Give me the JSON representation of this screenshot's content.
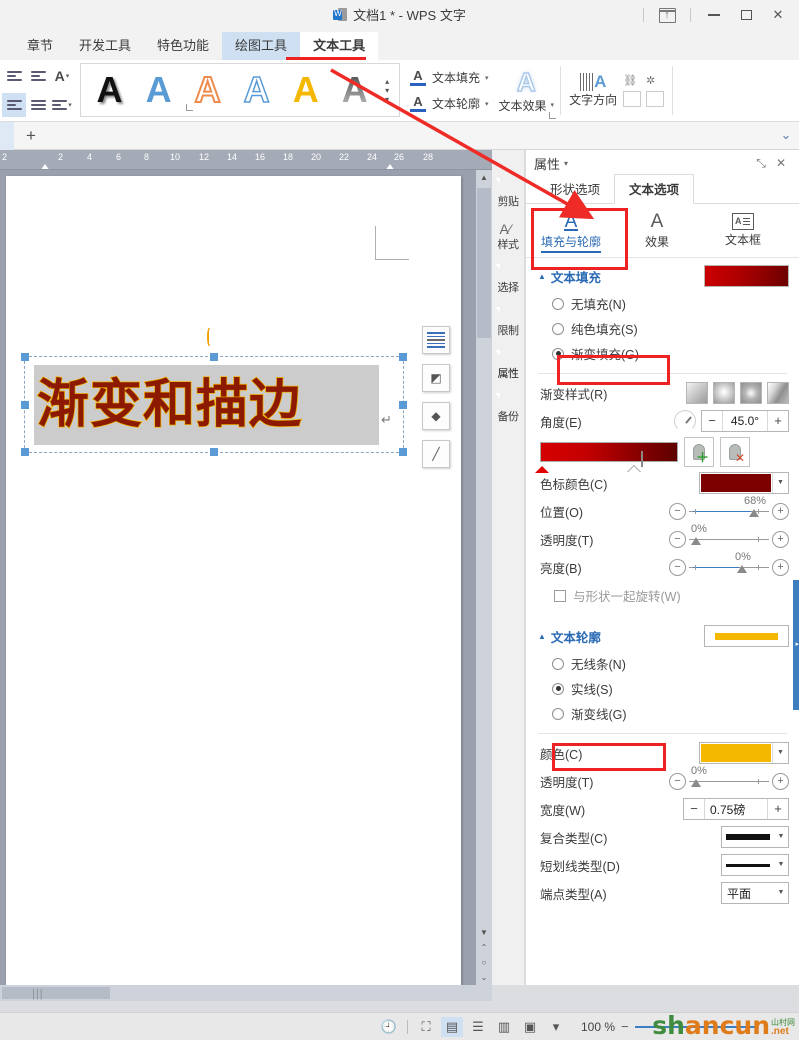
{
  "titlebar": {
    "document_title": "文档1 * - WPS 文字",
    "doc_icon": "wps-doc-icon",
    "upload_icon": "upload-to-cloud-icon",
    "minimize_icon": "minimize-icon",
    "maximize_icon": "maximize-icon",
    "close_icon": "close-icon"
  },
  "ribbon_tabs": [
    {
      "label": "章节",
      "state": "normal"
    },
    {
      "label": "开发工具",
      "state": "normal"
    },
    {
      "label": "特色功能",
      "state": "normal"
    },
    {
      "label": "绘图工具",
      "state": "contextual"
    },
    {
      "label": "文本工具",
      "state": "active"
    }
  ],
  "ribbon": {
    "paragraph_icons": [
      "decrease-indent-icon",
      "increase-indent-icon",
      "character-shading-icon",
      "align-left-icon",
      "distribute-text-icon",
      "line-spacing-icon"
    ],
    "wordart_gallery": [
      {
        "name": "wordart-black-shadow",
        "glyph": "A"
      },
      {
        "name": "wordart-blue-fill",
        "glyph": "A"
      },
      {
        "name": "wordart-orange-outline",
        "glyph": "A"
      },
      {
        "name": "wordart-blue-outline",
        "glyph": "A"
      },
      {
        "name": "wordart-gold-fill",
        "glyph": "A"
      },
      {
        "name": "wordart-gray-gradient",
        "glyph": "A"
      }
    ],
    "text_fill_label": "文本填充",
    "text_outline_label": "文本轮廓",
    "text_effects_label": "文本效果",
    "text_direction_label": "文字方向",
    "link_icon": "link-textbox-icon",
    "break_link_icon": "break-link-icon",
    "prev_textbox_icon": "previous-textbox-icon",
    "next_textbox_icon": "next-textbox-icon"
  },
  "doc_tabbar": {
    "add_tab_label": "+",
    "right_icon": "expand-ribbon-icon"
  },
  "ruler": {
    "ticks": [
      "2",
      "",
      "2",
      "4",
      "6",
      "8",
      "10",
      "12",
      "14",
      "16",
      "18",
      "20",
      "22",
      "24",
      "26",
      "28"
    ]
  },
  "canvas": {
    "wordart_text": "渐变和描边",
    "pilcrow": "↵",
    "quick_buttons": [
      "layout-options-icon",
      "edit-shape-icon",
      "fill-color-icon",
      "line-color-icon"
    ],
    "rotate_handle": "rotate-handle-icon"
  },
  "side_toolbar": [
    {
      "label": "剪贴",
      "icon": "clipboard-icon",
      "selected": false
    },
    {
      "label": "样式",
      "icon": "styles-icon",
      "selected": false
    },
    {
      "label": "选择",
      "icon": "select-icon",
      "selected": false
    },
    {
      "label": "限制",
      "icon": "restrict-edit-icon",
      "selected": false
    },
    {
      "label": "属性",
      "icon": "properties-icon",
      "selected": true
    },
    {
      "label": "备份",
      "icon": "backup-icon",
      "selected": false
    }
  ],
  "panel": {
    "title": "属性",
    "caret": "▾",
    "restore_icon": "restore-panel-icon",
    "close_icon": "close-panel-icon",
    "tabs": [
      {
        "label": "形状选项",
        "active": false
      },
      {
        "label": "文本选项",
        "active": true
      }
    ],
    "subtabs": [
      {
        "label": "填充与轮廓",
        "icon": "fill-and-outline-icon",
        "glyph": "A",
        "active": true
      },
      {
        "label": "效果",
        "icon": "effects-icon",
        "glyph": "A",
        "active": false
      },
      {
        "label": "文本框",
        "icon": "textbox-icon",
        "glyph": "A",
        "active": false
      }
    ],
    "text_fill": {
      "section_title": "文本填充",
      "preview_name": "gradient-preview-swatch",
      "options": [
        {
          "label": "无填充(N)",
          "underline": "N",
          "selected": false
        },
        {
          "label": "纯色填充(S)",
          "underline": "S",
          "selected": false
        },
        {
          "label": "渐变填充(G)",
          "underline": "G",
          "selected": true
        }
      ],
      "gradient_style_label": "渐变样式(R)",
      "gradient_styles": [
        "linear-gradient-style",
        "radial-gradient-style",
        "rectangular-gradient-style",
        "path-gradient-style"
      ],
      "angle_label": "角度(E)",
      "angle_value": "45.0°",
      "angle_minus": "−",
      "angle_plus": "+",
      "stop_add_icon": "add-gradient-stop-icon",
      "stop_remove_icon": "remove-gradient-stop-icon",
      "stop_color_label": "色标颜色(C)",
      "stop_color_hex": "#7D0000",
      "position_label": "位置(O)",
      "position_value": "68%",
      "transparency_label": "透明度(T)",
      "transparency_value": "0%",
      "brightness_label": "亮度(B)",
      "brightness_value": "0%",
      "rotate_with_shape_label": "与形状一起旋转(W)",
      "rotate_with_shape_checked": false
    },
    "text_outline": {
      "section_title": "文本轮廓",
      "preview_name": "outline-preview-swatch",
      "preview_color": "#F5B800",
      "options": [
        {
          "label": "无线条(N)",
          "underline": "N",
          "selected": false
        },
        {
          "label": "实线(S)",
          "underline": "S",
          "selected": true
        },
        {
          "label": "渐变线(G)",
          "underline": "G",
          "selected": false
        }
      ],
      "color_label": "颜色(C)",
      "color_hex": "#F5B800",
      "transparency_label": "透明度(T)",
      "transparency_value": "0%",
      "width_label": "宽度(W)",
      "width_value": "0.75磅",
      "width_minus": "−",
      "width_plus": "+",
      "compound_type_label": "复合类型(C)",
      "dash_type_label": "短划线类型(D)",
      "cap_type_label": "端点类型(A)",
      "cap_type_value": "平面"
    }
  },
  "statusbar": {
    "history_icon": "revision-history-icon",
    "fit_icon": "fit-page-icon",
    "view_icons": [
      "page-view-icon",
      "outline-view-icon",
      "web-view-icon",
      "reading-view-icon"
    ],
    "view_caret": "▾",
    "zoom_level": "100 %",
    "zoom_out": "−",
    "zoom_in": "+",
    "watermark_main_g": "sh",
    "watermark_main_a": "ancun",
    "watermark_cn": "山村网",
    "watermark_net": ".net"
  }
}
